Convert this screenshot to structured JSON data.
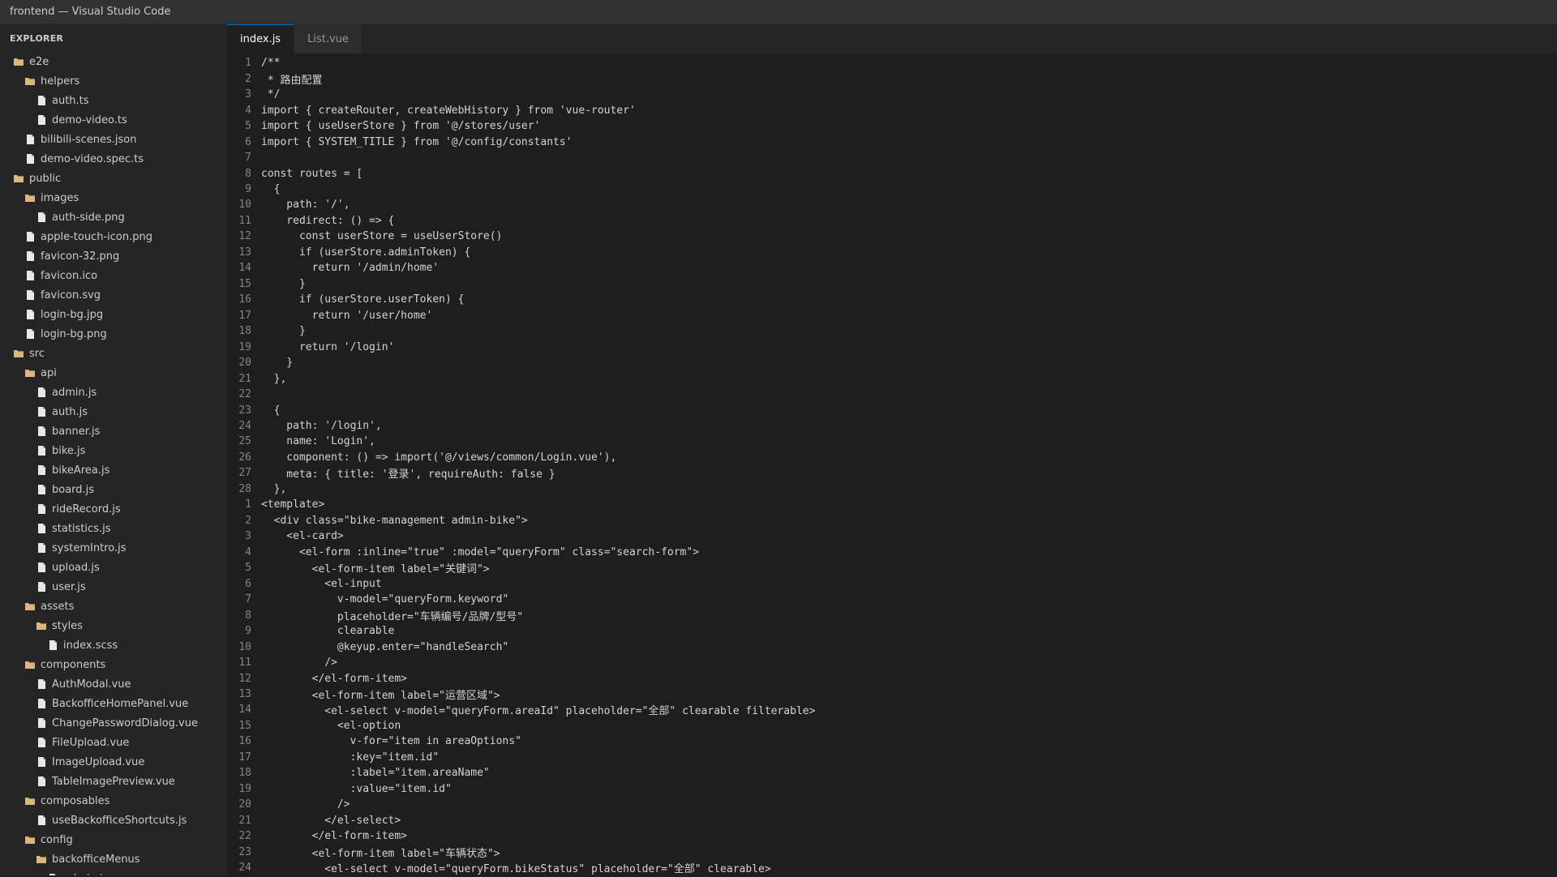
{
  "window": {
    "title": "frontend — Visual Studio Code"
  },
  "explorer": {
    "header": "EXPLORER",
    "items": [
      {
        "label": "e2e",
        "type": "folder",
        "depth": 0
      },
      {
        "label": "helpers",
        "type": "folder",
        "depth": 1
      },
      {
        "label": "auth.ts",
        "type": "file",
        "depth": 2
      },
      {
        "label": "demo-video.ts",
        "type": "file",
        "depth": 2
      },
      {
        "label": "bilibili-scenes.json",
        "type": "file",
        "depth": 1
      },
      {
        "label": "demo-video.spec.ts",
        "type": "file",
        "depth": 1
      },
      {
        "label": "public",
        "type": "folder",
        "depth": 0
      },
      {
        "label": "images",
        "type": "folder",
        "depth": 1
      },
      {
        "label": "auth-side.png",
        "type": "file",
        "depth": 2
      },
      {
        "label": "apple-touch-icon.png",
        "type": "file",
        "depth": 1
      },
      {
        "label": "favicon-32.png",
        "type": "file",
        "depth": 1
      },
      {
        "label": "favicon.ico",
        "type": "file",
        "depth": 1
      },
      {
        "label": "favicon.svg",
        "type": "file",
        "depth": 1
      },
      {
        "label": "login-bg.jpg",
        "type": "file",
        "depth": 1
      },
      {
        "label": "login-bg.png",
        "type": "file",
        "depth": 1
      },
      {
        "label": "src",
        "type": "folder",
        "depth": 0
      },
      {
        "label": "api",
        "type": "folder",
        "depth": 1
      },
      {
        "label": "admin.js",
        "type": "file",
        "depth": 2
      },
      {
        "label": "auth.js",
        "type": "file",
        "depth": 2
      },
      {
        "label": "banner.js",
        "type": "file",
        "depth": 2
      },
      {
        "label": "bike.js",
        "type": "file",
        "depth": 2
      },
      {
        "label": "bikeArea.js",
        "type": "file",
        "depth": 2
      },
      {
        "label": "board.js",
        "type": "file",
        "depth": 2
      },
      {
        "label": "rideRecord.js",
        "type": "file",
        "depth": 2
      },
      {
        "label": "statistics.js",
        "type": "file",
        "depth": 2
      },
      {
        "label": "systemIntro.js",
        "type": "file",
        "depth": 2
      },
      {
        "label": "upload.js",
        "type": "file",
        "depth": 2
      },
      {
        "label": "user.js",
        "type": "file",
        "depth": 2
      },
      {
        "label": "assets",
        "type": "folder",
        "depth": 1
      },
      {
        "label": "styles",
        "type": "folder",
        "depth": 2
      },
      {
        "label": "index.scss",
        "type": "file",
        "depth": 3
      },
      {
        "label": "components",
        "type": "folder",
        "depth": 1
      },
      {
        "label": "AuthModal.vue",
        "type": "file",
        "depth": 2
      },
      {
        "label": "BackofficeHomePanel.vue",
        "type": "file",
        "depth": 2
      },
      {
        "label": "ChangePasswordDialog.vue",
        "type": "file",
        "depth": 2
      },
      {
        "label": "FileUpload.vue",
        "type": "file",
        "depth": 2
      },
      {
        "label": "ImageUpload.vue",
        "type": "file",
        "depth": 2
      },
      {
        "label": "TableImagePreview.vue",
        "type": "file",
        "depth": 2
      },
      {
        "label": "composables",
        "type": "folder",
        "depth": 1
      },
      {
        "label": "useBackofficeShortcuts.js",
        "type": "file",
        "depth": 2
      },
      {
        "label": "config",
        "type": "folder",
        "depth": 1
      },
      {
        "label": "backofficeMenus",
        "type": "folder",
        "depth": 2
      },
      {
        "label": "admin.js",
        "type": "file",
        "depth": 3
      }
    ]
  },
  "tabs": [
    {
      "label": "index.js",
      "active": true
    },
    {
      "label": "List.vue",
      "active": false
    }
  ],
  "code": [
    {
      "n": "1",
      "text": "/**"
    },
    {
      "n": "2",
      "text": " * 路由配置"
    },
    {
      "n": "3",
      "text": " */"
    },
    {
      "n": "4",
      "text": "import { createRouter, createWebHistory } from 'vue-router'"
    },
    {
      "n": "5",
      "text": "import { useUserStore } from '@/stores/user'"
    },
    {
      "n": "6",
      "text": "import { SYSTEM_TITLE } from '@/config/constants'"
    },
    {
      "n": "7",
      "text": ""
    },
    {
      "n": "8",
      "text": "const routes = ["
    },
    {
      "n": "9",
      "text": "  {"
    },
    {
      "n": "10",
      "text": "    path: '/',"
    },
    {
      "n": "11",
      "text": "    redirect: () => {"
    },
    {
      "n": "12",
      "text": "      const userStore = useUserStore()"
    },
    {
      "n": "13",
      "text": "      if (userStore.adminToken) {"
    },
    {
      "n": "14",
      "text": "        return '/admin/home'"
    },
    {
      "n": "15",
      "text": "      }"
    },
    {
      "n": "16",
      "text": "      if (userStore.userToken) {"
    },
    {
      "n": "17",
      "text": "        return '/user/home'"
    },
    {
      "n": "18",
      "text": "      }"
    },
    {
      "n": "19",
      "text": "      return '/login'"
    },
    {
      "n": "20",
      "text": "    }"
    },
    {
      "n": "21",
      "text": "  },"
    },
    {
      "n": "22",
      "text": ""
    },
    {
      "n": "23",
      "text": "  {"
    },
    {
      "n": "24",
      "text": "    path: '/login',"
    },
    {
      "n": "25",
      "text": "    name: 'Login',"
    },
    {
      "n": "26",
      "text": "    component: () => import('@/views/common/Login.vue'),"
    },
    {
      "n": "27",
      "text": "    meta: { title: '登录', requireAuth: false }"
    },
    {
      "n": "28",
      "text": "  },"
    },
    {
      "n": "1",
      "text": "<template>"
    },
    {
      "n": "2",
      "text": "  <div class=\"bike-management admin-bike\">"
    },
    {
      "n": "3",
      "text": "    <el-card>"
    },
    {
      "n": "4",
      "text": "      <el-form :inline=\"true\" :model=\"queryForm\" class=\"search-form\">"
    },
    {
      "n": "5",
      "text": "        <el-form-item label=\"关键词\">"
    },
    {
      "n": "6",
      "text": "          <el-input"
    },
    {
      "n": "7",
      "text": "            v-model=\"queryForm.keyword\""
    },
    {
      "n": "8",
      "text": "            placeholder=\"车辆编号/品牌/型号\""
    },
    {
      "n": "9",
      "text": "            clearable"
    },
    {
      "n": "10",
      "text": "            @keyup.enter=\"handleSearch\""
    },
    {
      "n": "11",
      "text": "          />"
    },
    {
      "n": "12",
      "text": "        </el-form-item>"
    },
    {
      "n": "13",
      "text": "        <el-form-item label=\"运营区域\">"
    },
    {
      "n": "14",
      "text": "          <el-select v-model=\"queryForm.areaId\" placeholder=\"全部\" clearable filterable>"
    },
    {
      "n": "15",
      "text": "            <el-option"
    },
    {
      "n": "16",
      "text": "              v-for=\"item in areaOptions\""
    },
    {
      "n": "17",
      "text": "              :key=\"item.id\""
    },
    {
      "n": "18",
      "text": "              :label=\"item.areaName\""
    },
    {
      "n": "19",
      "text": "              :value=\"item.id\""
    },
    {
      "n": "20",
      "text": "            />"
    },
    {
      "n": "21",
      "text": "          </el-select>"
    },
    {
      "n": "22",
      "text": "        </el-form-item>"
    },
    {
      "n": "23",
      "text": "        <el-form-item label=\"车辆状态\">"
    },
    {
      "n": "24",
      "text": "          <el-select v-model=\"queryForm.bikeStatus\" placeholder=\"全部\" clearable>"
    }
  ]
}
